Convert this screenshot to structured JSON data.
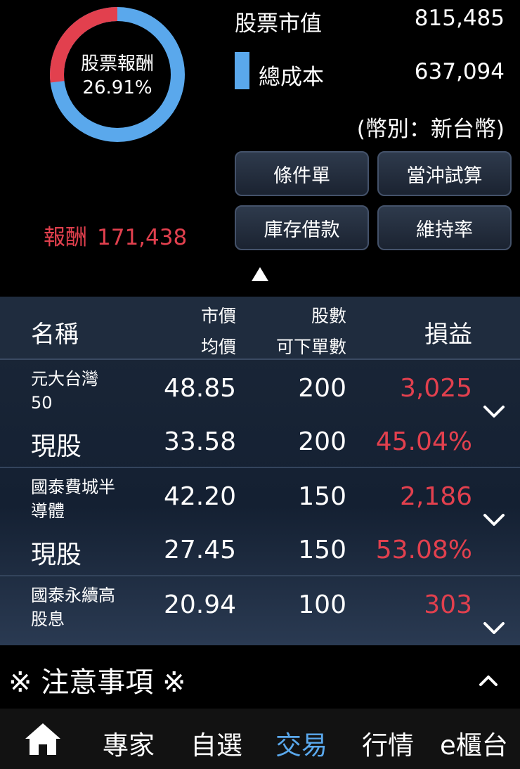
{
  "summary": {
    "donut_label": "股票報酬",
    "donut_pct": "26.91%",
    "donut_return_fraction": 0.2691,
    "market_value_label": "股票市值",
    "market_value": "815,485",
    "total_cost_label": "總成本",
    "total_cost": "637,094",
    "currency": "(幣別：新台幣)",
    "reward_label": "報酬",
    "reward_value": "171,438"
  },
  "buttons": {
    "conditional_order": "條件單",
    "day_trade_calc": "當沖試算",
    "inventory_loan": "庫存借款",
    "maintenance_rate": "維持率"
  },
  "table": {
    "headers": {
      "name": "名稱",
      "market_price": "市價",
      "avg_price": "均價",
      "shares": "股數",
      "sellable": "可下單數",
      "pl": "損益"
    },
    "rows": [
      {
        "name_line1": "元大台灣",
        "name_line2": "50",
        "type": "現股",
        "market_price": "48.85",
        "avg_price": "33.58",
        "shares": "200",
        "sellable": "200",
        "pl": "3,025",
        "pl_pct": "45.04%"
      },
      {
        "name_line1": "國泰費城半",
        "name_line2": "導體",
        "type": "現股",
        "market_price": "42.20",
        "avg_price": "27.45",
        "shares": "150",
        "sellable": "150",
        "pl": "2,186",
        "pl_pct": "53.08%"
      },
      {
        "name_line1": "國泰永續高",
        "name_line2": "股息",
        "type": "",
        "market_price": "20.94",
        "avg_price": "",
        "shares": "100",
        "sellable": "",
        "pl": "303",
        "pl_pct": ""
      }
    ]
  },
  "notice": {
    "text": "※ 注意事項 ※"
  },
  "nav": {
    "home_icon": "home-icon",
    "items": [
      "專家",
      "自選",
      "交易",
      "行情",
      "e櫃台"
    ],
    "active": "交易"
  },
  "colors": {
    "accent_blue": "#5aa8ec",
    "loss_red": "#e2404e",
    "gain_red": "#e2404e"
  }
}
